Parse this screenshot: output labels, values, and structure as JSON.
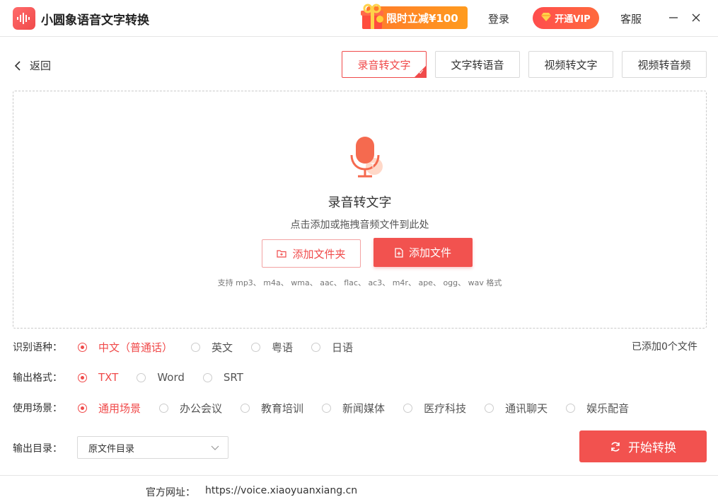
{
  "app": {
    "title": "小圆象语音文字转换",
    "promo_label": "限时立减¥100",
    "login_label": "登录",
    "vip_label": "开通VIP",
    "service_label": "客服"
  },
  "nav": {
    "back_label": "返回",
    "tabs": [
      {
        "label": "录音转文字",
        "active": true
      },
      {
        "label": "文字转语音",
        "active": false
      },
      {
        "label": "视频转文字",
        "active": false
      },
      {
        "label": "视频转音频",
        "active": false
      }
    ]
  },
  "dropzone": {
    "title": "录音转文字",
    "hint": "点击添加或拖拽音频文件到此处",
    "add_folder_label": "添加文件夹",
    "add_file_label": "添加文件",
    "formats": "支持 mp3、 m4a、 wma、 aac、 flac、 ac3、 m4r、 ape、 ogg、 wav 格式"
  },
  "options": {
    "language": {
      "label": "识别语种：",
      "choices": [
        "中文（普通话）",
        "英文",
        "粤语",
        "日语"
      ],
      "selected": 0
    },
    "format": {
      "label": "输出格式：",
      "choices": [
        "TXT",
        "Word",
        "SRT"
      ],
      "selected": 0
    },
    "scene": {
      "label": "使用场景：",
      "choices": [
        "通用场景",
        "办公会议",
        "教育培训",
        "新闻媒体",
        "医疗科技",
        "通讯聊天",
        "娱乐配音"
      ],
      "selected": 0
    },
    "file_count": "已添加0个文件",
    "output_dir": {
      "label": "输出目录：",
      "value": "原文件目录"
    },
    "start_label": "开始转换"
  },
  "footer": {
    "site_label": "官方网址：",
    "site_url": "https://voice.xiaoyuanxiang.cn"
  },
  "colors": {
    "accent": "#f04a4a",
    "promo": "#ff8a24"
  }
}
